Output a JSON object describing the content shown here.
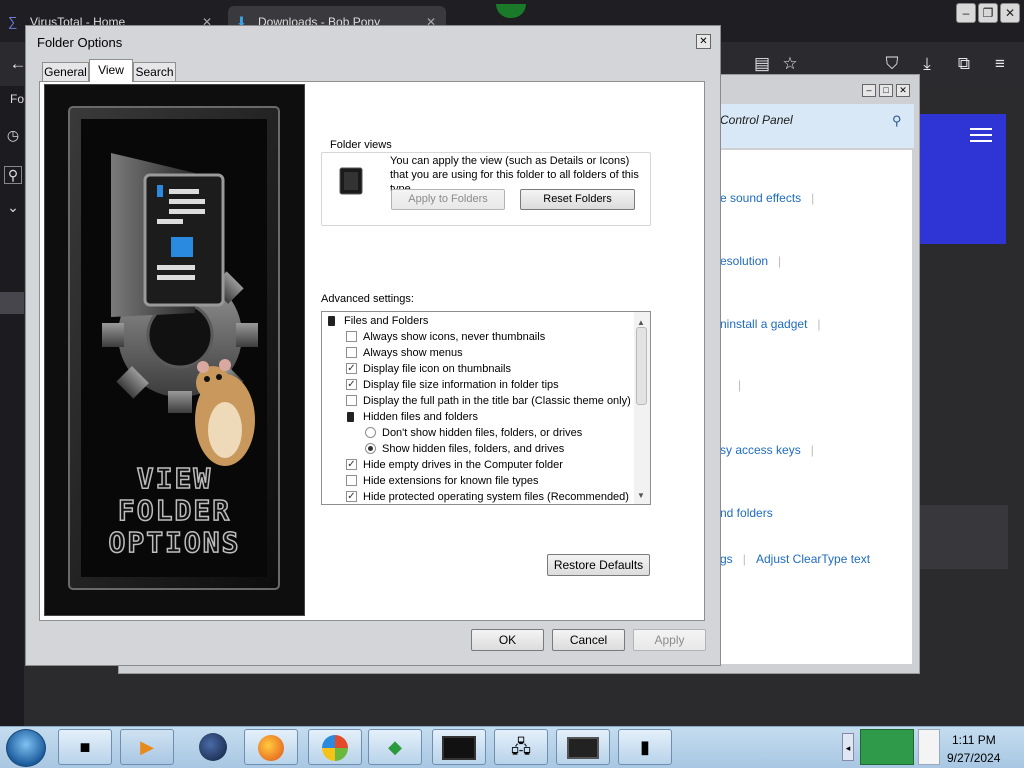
{
  "browser": {
    "tabs": [
      {
        "title": "VirusTotal - Home",
        "close": "✕"
      },
      {
        "title": "Downloads - Bob Pony",
        "close": "✕"
      }
    ],
    "sidebar_label": "Fo"
  },
  "control_panel": {
    "breadcrumb": "Control Panel",
    "links": [
      "e sound effects",
      "esolution",
      "ninstall a gadget",
      "sy access keys",
      "nd folders",
      "gs",
      "Adjust ClearType text"
    ]
  },
  "dialog": {
    "title": "Folder Options",
    "close": "✕",
    "tabs": [
      "General",
      "View",
      "Search"
    ],
    "active_tab": "View",
    "art_text": [
      "VIEW",
      "FOLDER",
      "OPTIONS"
    ],
    "folder_views": {
      "label": "Folder views",
      "description": "You can apply the view (such as Details or Icons) that you are using for this folder to all folders of this type.",
      "apply_button": "Apply to Folders",
      "reset_button": "Reset Folders"
    },
    "advanced": {
      "label": "Advanced settings:",
      "items": [
        {
          "kind": "folder",
          "label": "Files and Folders",
          "indent": 0
        },
        {
          "kind": "check",
          "checked": false,
          "label": "Always show icons, never thumbnails",
          "indent": 1
        },
        {
          "kind": "check",
          "checked": false,
          "label": "Always show menus",
          "indent": 1
        },
        {
          "kind": "check",
          "checked": true,
          "label": "Display file icon on thumbnails",
          "indent": 1
        },
        {
          "kind": "check",
          "checked": true,
          "label": "Display file size information in folder tips",
          "indent": 1
        },
        {
          "kind": "check",
          "checked": false,
          "label": "Display the full path in the title bar (Classic theme only)",
          "indent": 1
        },
        {
          "kind": "folder",
          "label": "Hidden files and folders",
          "indent": 1
        },
        {
          "kind": "radio",
          "checked": false,
          "label": "Don't show hidden files, folders, or drives",
          "indent": 2
        },
        {
          "kind": "radio",
          "checked": true,
          "label": "Show hidden files, folders, and drives",
          "indent": 2
        },
        {
          "kind": "check",
          "checked": true,
          "label": "Hide empty drives in the Computer folder",
          "indent": 1
        },
        {
          "kind": "check",
          "checked": false,
          "label": "Hide extensions for known file types",
          "indent": 1
        },
        {
          "kind": "check",
          "checked": true,
          "label": "Hide protected operating system files (Recommended)",
          "indent": 1
        }
      ]
    },
    "restore_button": "Restore Defaults",
    "ok_button": "OK",
    "cancel_button": "Cancel",
    "apply_button": "Apply"
  },
  "taskbar": {
    "time": "1:11 PM",
    "date": "9/27/2024"
  }
}
